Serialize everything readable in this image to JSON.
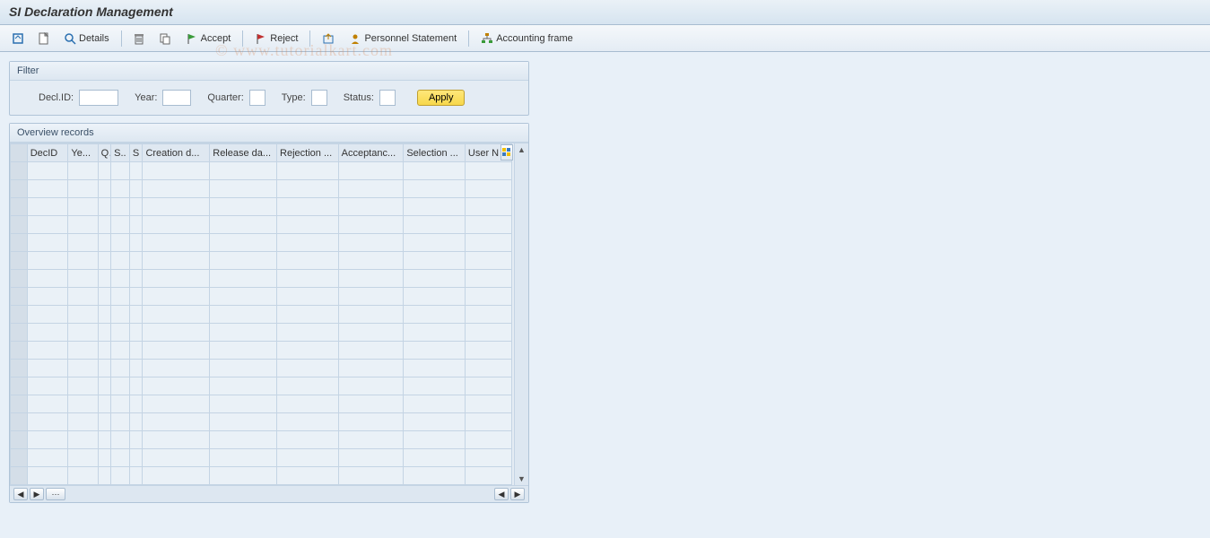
{
  "title": "SI Declaration Management",
  "toolbar": {
    "details_label": "Details",
    "accept_label": "Accept",
    "reject_label": "Reject",
    "personnel_label": "Personnel Statement",
    "accounting_label": "Accounting frame"
  },
  "filter": {
    "panel_title": "Filter",
    "declid_label": "Decl.ID:",
    "year_label": "Year:",
    "quarter_label": "Quarter:",
    "type_label": "Type:",
    "status_label": "Status:",
    "apply_label": "Apply",
    "declid_value": "",
    "year_value": "",
    "quarter_value": "",
    "type_value": "",
    "status_value": ""
  },
  "overview": {
    "panel_title": "Overview records",
    "columns": [
      "DecID",
      "Ye...",
      "Q",
      "S..",
      "S",
      "Creation d...",
      "Release da...",
      "Rejection ...",
      "Acceptanc...",
      "Selection ...",
      "User N"
    ],
    "rows": [
      [
        "",
        "",
        "",
        "",
        "",
        "",
        "",
        "",
        "",
        "",
        ""
      ],
      [
        "",
        "",
        "",
        "",
        "",
        "",
        "",
        "",
        "",
        "",
        ""
      ],
      [
        "",
        "",
        "",
        "",
        "",
        "",
        "",
        "",
        "",
        "",
        ""
      ],
      [
        "",
        "",
        "",
        "",
        "",
        "",
        "",
        "",
        "",
        "",
        ""
      ],
      [
        "",
        "",
        "",
        "",
        "",
        "",
        "",
        "",
        "",
        "",
        ""
      ],
      [
        "",
        "",
        "",
        "",
        "",
        "",
        "",
        "",
        "",
        "",
        ""
      ],
      [
        "",
        "",
        "",
        "",
        "",
        "",
        "",
        "",
        "",
        "",
        ""
      ],
      [
        "",
        "",
        "",
        "",
        "",
        "",
        "",
        "",
        "",
        "",
        ""
      ],
      [
        "",
        "",
        "",
        "",
        "",
        "",
        "",
        "",
        "",
        "",
        ""
      ],
      [
        "",
        "",
        "",
        "",
        "",
        "",
        "",
        "",
        "",
        "",
        ""
      ],
      [
        "",
        "",
        "",
        "",
        "",
        "",
        "",
        "",
        "",
        "",
        ""
      ],
      [
        "",
        "",
        "",
        "",
        "",
        "",
        "",
        "",
        "",
        "",
        ""
      ],
      [
        "",
        "",
        "",
        "",
        "",
        "",
        "",
        "",
        "",
        "",
        ""
      ],
      [
        "",
        "",
        "",
        "",
        "",
        "",
        "",
        "",
        "",
        "",
        ""
      ],
      [
        "",
        "",
        "",
        "",
        "",
        "",
        "",
        "",
        "",
        "",
        ""
      ],
      [
        "",
        "",
        "",
        "",
        "",
        "",
        "",
        "",
        "",
        "",
        ""
      ],
      [
        "",
        "",
        "",
        "",
        "",
        "",
        "",
        "",
        "",
        "",
        ""
      ],
      [
        "",
        "",
        "",
        "",
        "",
        "",
        "",
        "",
        "",
        "",
        ""
      ]
    ]
  },
  "watermark_text": "© www.tutorialkart.com"
}
